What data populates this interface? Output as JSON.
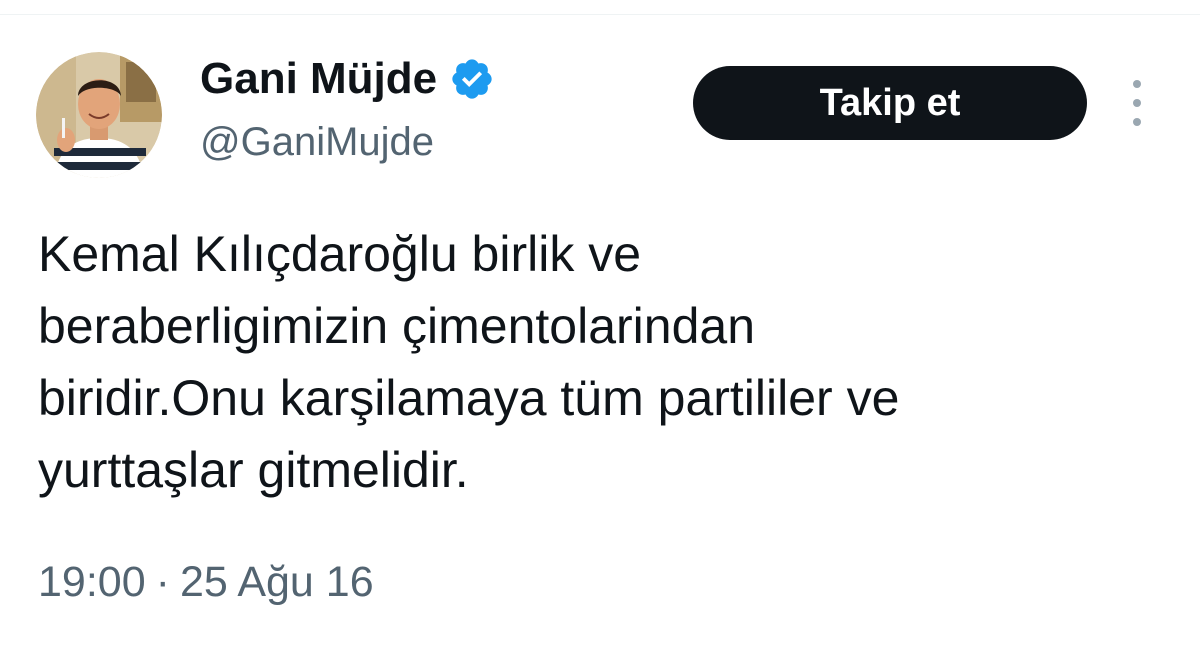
{
  "tweet": {
    "author": {
      "display_name": "Gani Müjde",
      "handle": "@GaniMujde",
      "verified": true,
      "avatar_icon": "profile-photo"
    },
    "follow_button_label": "Takip et",
    "more_icon": "more-vertical-icon",
    "text_lines": [
      "Kemal Kılıçdaroğlu birlik ve",
      "beraberligimizin çimentolarindan",
      "biridir.Onu karşilamaya tüm partililer ve",
      "yurttaşlar gitmelidir."
    ],
    "time": "19:00",
    "separator": "·",
    "date": "25 Ağu 16"
  },
  "colors": {
    "primary_text": "#0f1419",
    "secondary_text": "#536471",
    "verified_badge": "#1d9bf0",
    "follow_button_bg": "#0f1419",
    "follow_button_text": "#ffffff",
    "divider": "#eff3f4"
  }
}
